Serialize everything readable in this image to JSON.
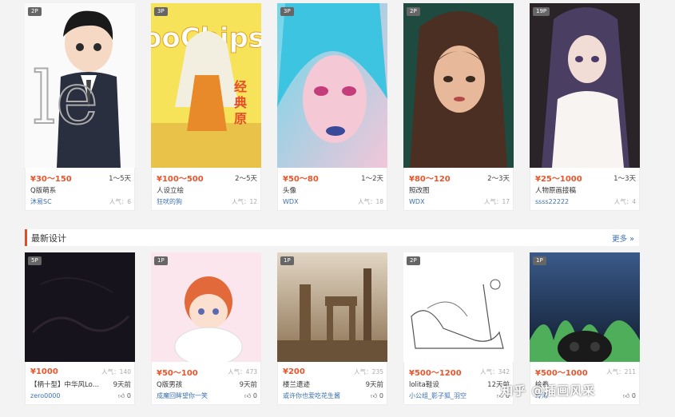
{
  "section": {
    "title": "最新设计",
    "more": "更多 »"
  },
  "watermark": "知乎 @插画风采",
  "colors": {
    "accent": "#e24a2a",
    "price": "#e4572e",
    "link": "#3a6fb0"
  },
  "top_cards": [
    {
      "badge": "2P",
      "price": "¥30～150",
      "days": "1～5天",
      "title": "Q版萌系",
      "author": "沐易SC",
      "popularity": "人气：6"
    },
    {
      "badge": "3P",
      "price": "¥100～500",
      "days": "2～5天",
      "title": "人设立绘",
      "author": "狂吠的狗",
      "popularity": "人气：12"
    },
    {
      "badge": "3P",
      "price": "¥50～80",
      "days": "1～2天",
      "title": "头像",
      "author": "WDX",
      "popularity": "人气：18"
    },
    {
      "badge": "2P",
      "price": "¥80～120",
      "days": "2～3天",
      "title": "照改图",
      "author": "WDX",
      "popularity": "人气：17"
    },
    {
      "badge": "19P",
      "price": "¥25～1000",
      "days": "1～3天",
      "title": "人物原画接稿",
      "author": "ssss22222",
      "popularity": "人气：4"
    }
  ],
  "bottom_cards": [
    {
      "badge": "5P",
      "price": "¥1000",
      "popularity": "人气：140",
      "title": "【柄十型】中华风Lo…",
      "days": "9天前",
      "author": "zero0000",
      "likes": "0"
    },
    {
      "badge": "1P",
      "price": "¥50～100",
      "popularity": "人气：473",
      "title": "Q版男孩",
      "days": "9天前",
      "author": "成魔回眸望你一笑",
      "likes": "0"
    },
    {
      "badge": "1P",
      "price": "¥200",
      "popularity": "人气：235",
      "title": "楼兰遗迹",
      "days": "9天前",
      "author": "或许你也爱吃花生酱",
      "likes": "0"
    },
    {
      "badge": "2P",
      "price": "¥500～1200",
      "popularity": "人气：342",
      "title": "lolita鞋设",
      "days": "12天前",
      "author": "小公组_影子狐_羽空",
      "likes": "0"
    },
    {
      "badge": "1P",
      "price": "¥500～1000",
      "popularity": "人气：211",
      "title": "绘卷",
      "days": "",
      "author": "玲浠",
      "likes": "0"
    }
  ]
}
